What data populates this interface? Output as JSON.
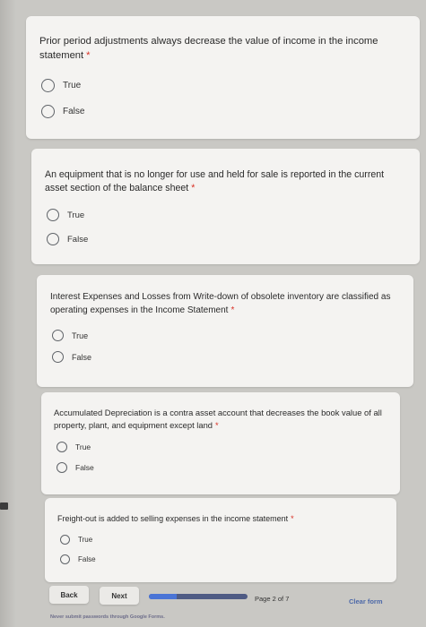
{
  "required_marker": "*",
  "questions": [
    {
      "text": "Prior period adjustments always decrease the value of income in the income statement",
      "options": [
        "True",
        "False"
      ]
    },
    {
      "text": "An equipment that is no longer for use and held for sale is reported in the current asset section of the balance sheet",
      "options": [
        "True",
        "False"
      ]
    },
    {
      "text": "Interest Expenses and Losses from Write-down of obsolete inventory are classified as operating expenses in the Income Statement",
      "options": [
        "True",
        "False"
      ]
    },
    {
      "text": "Accumulated Depreciation is a contra asset account that decreases the book value of all property, plant, and equipment except land",
      "options": [
        "True",
        "False"
      ]
    },
    {
      "text": "Freight-out is added to selling expenses in the income statement",
      "options": [
        "True",
        "False"
      ]
    }
  ],
  "nav": {
    "back_label": "Back",
    "next_label": "Next",
    "page_label": "Page 2 of 7",
    "progress_fraction": 0.286,
    "clear_label": "Clear form"
  },
  "footer_note": "Never submit passwords through Google Forms.",
  "colors": {
    "accent": "#4a74d6",
    "required": "#d93025",
    "link": "#4c68a8"
  }
}
